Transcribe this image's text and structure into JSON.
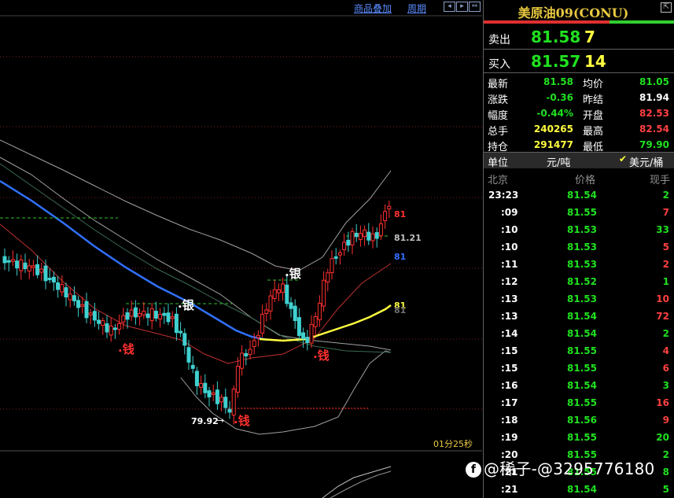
{
  "toolbar": {
    "overlay_label": "商品叠加",
    "period_label": "周期",
    "nav_icons": [
      "arrow-left-icon",
      "arrow-right-icon",
      "arrow-expand-icon"
    ]
  },
  "chart": {
    "timer": "01分25秒",
    "annotations": {
      "low_price": "79.92",
      "price_81": "81",
      "price_81_21": "81.21",
      "price_81_blue": "81",
      "price_81_yellow": "81",
      "marker_qian": "钱",
      "marker_yin": "银"
    },
    "colors": {
      "up": "#ff3030",
      "down": "#40d0d0",
      "ma_blue": "#3070ff",
      "ma_yellow": "#ffff40",
      "band": "#a0a0a0"
    }
  },
  "watermark": {
    "logo": "f",
    "text": "@稀子-@3295776180"
  },
  "panel": {
    "title": "美原油09(CONU)",
    "ask": {
      "label": "卖出",
      "price": "81.58",
      "volume": "7"
    },
    "bid": {
      "label": "买入",
      "price": "81.57",
      "volume": "14"
    },
    "stats": [
      {
        "l1": "最新",
        "v1": "81.58",
        "c1": "#20e020",
        "l2": "均价",
        "v2": "81.05",
        "c2": "#20e020"
      },
      {
        "l1": "涨跌",
        "v1": "-0.36",
        "c1": "#20e020",
        "l2": "昨结",
        "v2": "81.94",
        "c2": "#ffffff"
      },
      {
        "l1": "幅度",
        "v1": "-0.44%",
        "c1": "#20e020",
        "l2": "开盘",
        "v2": "82.53",
        "c2": "#ff4040"
      },
      {
        "l1": "总手",
        "v1": "240265",
        "c1": "#ffff40",
        "l2": "最高",
        "v2": "82.54",
        "c2": "#ff4040"
      },
      {
        "l1": "持仓",
        "v1": "291477",
        "c1": "#ffff40",
        "l2": "最低",
        "v2": "79.90",
        "c2": "#20e020"
      }
    ],
    "unit": {
      "label": "单位",
      "option1": "元/吨",
      "option2": "美元/桶",
      "check": "✔"
    },
    "ticks_header": {
      "time": "北京",
      "price": "价格",
      "volume": "现手"
    },
    "ticks": [
      {
        "time": "23:23",
        "price": "81.54",
        "vol": "2",
        "vol_color": "#20e020"
      },
      {
        "time": ":09",
        "price": "81.55",
        "vol": "7",
        "vol_color": "#ff4040"
      },
      {
        "time": ":10",
        "price": "81.53",
        "vol": "33",
        "vol_color": "#20e020"
      },
      {
        "time": ":10",
        "price": "81.53",
        "vol": "5",
        "vol_color": "#ff4040"
      },
      {
        "time": ":11",
        "price": "81.53",
        "vol": "2",
        "vol_color": "#ff4040"
      },
      {
        "time": ":12",
        "price": "81.52",
        "vol": "1",
        "vol_color": "#20e020"
      },
      {
        "time": ":13",
        "price": "81.53",
        "vol": "10",
        "vol_color": "#ff4040"
      },
      {
        "time": ":13",
        "price": "81.54",
        "vol": "72",
        "vol_color": "#ff4040"
      },
      {
        "time": ":14",
        "price": "81.54",
        "vol": "2",
        "vol_color": "#20e020"
      },
      {
        "time": ":15",
        "price": "81.55",
        "vol": "4",
        "vol_color": "#ff4040"
      },
      {
        "time": ":15",
        "price": "81.55",
        "vol": "6",
        "vol_color": "#ff4040"
      },
      {
        "time": ":16",
        "price": "81.54",
        "vol": "3",
        "vol_color": "#20e020"
      },
      {
        "time": ":17",
        "price": "81.55",
        "vol": "16",
        "vol_color": "#ff4040"
      },
      {
        "time": ":18",
        "price": "81.56",
        "vol": "9",
        "vol_color": "#ff4040"
      },
      {
        "time": ":19",
        "price": "81.55",
        "vol": "20",
        "vol_color": "#20e020"
      },
      {
        "time": ":20",
        "price": "81.55",
        "vol": "2",
        "vol_color": "#20e020"
      },
      {
        "time": ":21",
        "price": "81.55",
        "vol": "8",
        "vol_color": "#20e020"
      },
      {
        "time": ":21",
        "price": "81.54",
        "vol": "5",
        "vol_color": "#20e020"
      }
    ]
  }
}
